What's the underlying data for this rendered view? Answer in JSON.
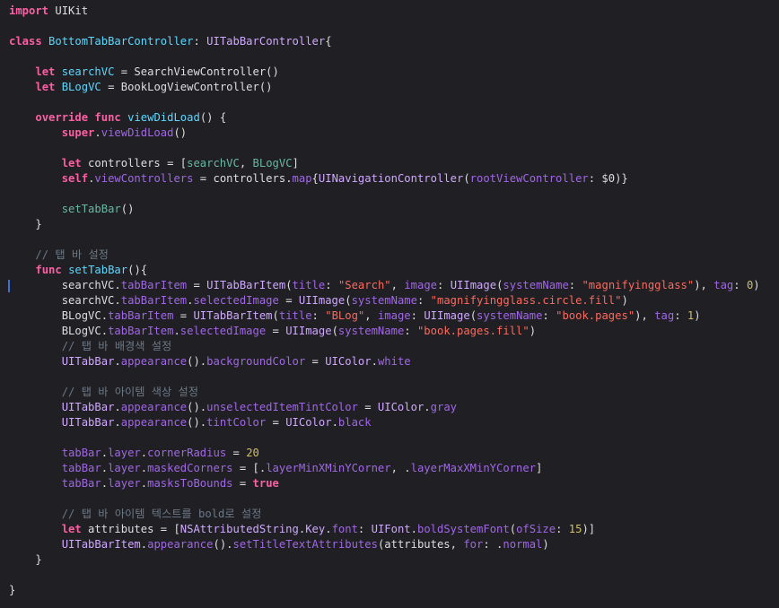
{
  "editor": {
    "theme_colors": {
      "background": "#1f1f24",
      "keyword": "#fc5fa3",
      "type": "#d0a8ff",
      "member": "#a167e6",
      "project_member": "#67b7a4",
      "declaration": "#5dd8ff",
      "string": "#fc6a5d",
      "number": "#d0bf69",
      "comment": "#6c7986",
      "text": "#dfdfe0"
    },
    "lines": [
      [
        {
          "k": "kw",
          "t": "import"
        },
        {
          "k": "tx",
          "t": " UIKit"
        }
      ],
      [],
      [
        {
          "k": "kw",
          "t": "class"
        },
        {
          "k": "tx",
          "t": " "
        },
        {
          "k": "cl",
          "t": "BottomTabBarController"
        },
        {
          "k": "tx",
          "t": ": "
        },
        {
          "k": "ty",
          "t": "UITabBarController"
        },
        {
          "k": "tx",
          "t": "{"
        }
      ],
      [],
      [
        {
          "k": "tx",
          "t": "    "
        },
        {
          "k": "kw",
          "t": "let"
        },
        {
          "k": "tx",
          "t": " "
        },
        {
          "k": "cl",
          "t": "searchVC"
        },
        {
          "k": "tx",
          "t": " = SearchViewController()"
        }
      ],
      [
        {
          "k": "tx",
          "t": "    "
        },
        {
          "k": "kw",
          "t": "let"
        },
        {
          "k": "tx",
          "t": " "
        },
        {
          "k": "cl",
          "t": "BLogVC"
        },
        {
          "k": "tx",
          "t": " = BookLogViewController()"
        }
      ],
      [],
      [
        {
          "k": "tx",
          "t": "    "
        },
        {
          "k": "kw",
          "t": "override"
        },
        {
          "k": "tx",
          "t": " "
        },
        {
          "k": "kw",
          "t": "func"
        },
        {
          "k": "tx",
          "t": " "
        },
        {
          "k": "cl",
          "t": "viewDidLoad"
        },
        {
          "k": "tx",
          "t": "() {"
        }
      ],
      [
        {
          "k": "tx",
          "t": "        "
        },
        {
          "k": "kw",
          "t": "super"
        },
        {
          "k": "tx",
          "t": "."
        },
        {
          "k": "pm",
          "t": "viewDidLoad"
        },
        {
          "k": "tx",
          "t": "()"
        }
      ],
      [],
      [
        {
          "k": "tx",
          "t": "        "
        },
        {
          "k": "kw",
          "t": "let"
        },
        {
          "k": "tx",
          "t": " controllers = ["
        },
        {
          "k": "fn",
          "t": "searchVC"
        },
        {
          "k": "tx",
          "t": ", "
        },
        {
          "k": "fn",
          "t": "BLogVC"
        },
        {
          "k": "tx",
          "t": "]"
        }
      ],
      [
        {
          "k": "tx",
          "t": "        "
        },
        {
          "k": "kw",
          "t": "self"
        },
        {
          "k": "tx",
          "t": "."
        },
        {
          "k": "pm",
          "t": "viewControllers"
        },
        {
          "k": "tx",
          "t": " = controllers."
        },
        {
          "k": "pm",
          "t": "map"
        },
        {
          "k": "tx",
          "t": "{"
        },
        {
          "k": "ty",
          "t": "UINavigationController"
        },
        {
          "k": "tx",
          "t": "("
        },
        {
          "k": "pm",
          "t": "rootViewController"
        },
        {
          "k": "tx",
          "t": ": $0)}"
        }
      ],
      [],
      [
        {
          "k": "tx",
          "t": "        "
        },
        {
          "k": "fn",
          "t": "setTabBar"
        },
        {
          "k": "tx",
          "t": "()"
        }
      ],
      [
        {
          "k": "tx",
          "t": "    }"
        }
      ],
      [],
      [
        {
          "k": "tx",
          "t": "    "
        },
        {
          "k": "cm",
          "t": "// 탭 바 설정"
        }
      ],
      [
        {
          "k": "tx",
          "t": "    "
        },
        {
          "k": "kw",
          "t": "func"
        },
        {
          "k": "tx",
          "t": " "
        },
        {
          "k": "cl",
          "t": "setTabBar"
        },
        {
          "k": "tx",
          "t": "(){"
        }
      ],
      [
        {
          "k": "tx",
          "t": "        searchVC."
        },
        {
          "k": "pm",
          "t": "tabBarItem"
        },
        {
          "k": "tx",
          "t": " = "
        },
        {
          "k": "ty",
          "t": "UITabBarItem"
        },
        {
          "k": "tx",
          "t": "("
        },
        {
          "k": "pm",
          "t": "title"
        },
        {
          "k": "tx",
          "t": ": "
        },
        {
          "k": "st",
          "t": "\"Search\""
        },
        {
          "k": "tx",
          "t": ", "
        },
        {
          "k": "pm",
          "t": "image"
        },
        {
          "k": "tx",
          "t": ": "
        },
        {
          "k": "ty",
          "t": "UIImage"
        },
        {
          "k": "tx",
          "t": "("
        },
        {
          "k": "pm",
          "t": "systemName"
        },
        {
          "k": "tx",
          "t": ": "
        },
        {
          "k": "st",
          "t": "\"magnifyingglass\""
        },
        {
          "k": "tx",
          "t": "), "
        },
        {
          "k": "pm",
          "t": "tag"
        },
        {
          "k": "tx",
          "t": ": "
        },
        {
          "k": "nu",
          "t": "0"
        },
        {
          "k": "tx",
          "t": ")"
        }
      ],
      [
        {
          "k": "tx",
          "t": "        searchVC."
        },
        {
          "k": "pm",
          "t": "tabBarItem"
        },
        {
          "k": "tx",
          "t": "."
        },
        {
          "k": "pm",
          "t": "selectedImage"
        },
        {
          "k": "tx",
          "t": " = "
        },
        {
          "k": "ty",
          "t": "UIImage"
        },
        {
          "k": "tx",
          "t": "("
        },
        {
          "k": "pm",
          "t": "systemName"
        },
        {
          "k": "tx",
          "t": ": "
        },
        {
          "k": "st",
          "t": "\"magnifyingglass.circle.fill\""
        },
        {
          "k": "tx",
          "t": ")"
        }
      ],
      [
        {
          "k": "tx",
          "t": "        BLogVC."
        },
        {
          "k": "pm",
          "t": "tabBarItem"
        },
        {
          "k": "tx",
          "t": " = "
        },
        {
          "k": "ty",
          "t": "UITabBarItem"
        },
        {
          "k": "tx",
          "t": "("
        },
        {
          "k": "pm",
          "t": "title"
        },
        {
          "k": "tx",
          "t": ": "
        },
        {
          "k": "st",
          "t": "\"BLog\""
        },
        {
          "k": "tx",
          "t": ", "
        },
        {
          "k": "pm",
          "t": "image"
        },
        {
          "k": "tx",
          "t": ": "
        },
        {
          "k": "ty",
          "t": "UIImage"
        },
        {
          "k": "tx",
          "t": "("
        },
        {
          "k": "pm",
          "t": "systemName"
        },
        {
          "k": "tx",
          "t": ": "
        },
        {
          "k": "st",
          "t": "\"book.pages\""
        },
        {
          "k": "tx",
          "t": "), "
        },
        {
          "k": "pm",
          "t": "tag"
        },
        {
          "k": "tx",
          "t": ": "
        },
        {
          "k": "nu",
          "t": "1"
        },
        {
          "k": "tx",
          "t": ")"
        }
      ],
      [
        {
          "k": "tx",
          "t": "        BLogVC."
        },
        {
          "k": "pm",
          "t": "tabBarItem"
        },
        {
          "k": "tx",
          "t": "."
        },
        {
          "k": "pm",
          "t": "selectedImage"
        },
        {
          "k": "tx",
          "t": " = "
        },
        {
          "k": "ty",
          "t": "UIImage"
        },
        {
          "k": "tx",
          "t": "("
        },
        {
          "k": "pm",
          "t": "systemName"
        },
        {
          "k": "tx",
          "t": ": "
        },
        {
          "k": "st",
          "t": "\"book.pages.fill\""
        },
        {
          "k": "tx",
          "t": ")"
        }
      ],
      [
        {
          "k": "tx",
          "t": "        "
        },
        {
          "k": "cm",
          "t": "// 탭 바 배경색 설정"
        }
      ],
      [
        {
          "k": "tx",
          "t": "        "
        },
        {
          "k": "ty",
          "t": "UITabBar"
        },
        {
          "k": "tx",
          "t": "."
        },
        {
          "k": "pm",
          "t": "appearance"
        },
        {
          "k": "tx",
          "t": "()."
        },
        {
          "k": "pm",
          "t": "backgroundColor"
        },
        {
          "k": "tx",
          "t": " = "
        },
        {
          "k": "ty",
          "t": "UIColor"
        },
        {
          "k": "tx",
          "t": "."
        },
        {
          "k": "pm",
          "t": "white"
        }
      ],
      [],
      [
        {
          "k": "tx",
          "t": "        "
        },
        {
          "k": "cm",
          "t": "// 탭 바 아이템 색상 설정"
        }
      ],
      [
        {
          "k": "tx",
          "t": "        "
        },
        {
          "k": "ty",
          "t": "UITabBar"
        },
        {
          "k": "tx",
          "t": "."
        },
        {
          "k": "pm",
          "t": "appearance"
        },
        {
          "k": "tx",
          "t": "()."
        },
        {
          "k": "pm",
          "t": "unselectedItemTintColor"
        },
        {
          "k": "tx",
          "t": " = "
        },
        {
          "k": "ty",
          "t": "UIColor"
        },
        {
          "k": "tx",
          "t": "."
        },
        {
          "k": "pm",
          "t": "gray"
        }
      ],
      [
        {
          "k": "tx",
          "t": "        "
        },
        {
          "k": "ty",
          "t": "UITabBar"
        },
        {
          "k": "tx",
          "t": "."
        },
        {
          "k": "pm",
          "t": "appearance"
        },
        {
          "k": "tx",
          "t": "()."
        },
        {
          "k": "pm",
          "t": "tintColor"
        },
        {
          "k": "tx",
          "t": " = "
        },
        {
          "k": "ty",
          "t": "UIColor"
        },
        {
          "k": "tx",
          "t": "."
        },
        {
          "k": "pm",
          "t": "black"
        }
      ],
      [],
      [
        {
          "k": "tx",
          "t": "        "
        },
        {
          "k": "pm",
          "t": "tabBar"
        },
        {
          "k": "tx",
          "t": "."
        },
        {
          "k": "pm",
          "t": "layer"
        },
        {
          "k": "tx",
          "t": "."
        },
        {
          "k": "pm",
          "t": "cornerRadius"
        },
        {
          "k": "tx",
          "t": " = "
        },
        {
          "k": "nu",
          "t": "20"
        }
      ],
      [
        {
          "k": "tx",
          "t": "        "
        },
        {
          "k": "pm",
          "t": "tabBar"
        },
        {
          "k": "tx",
          "t": "."
        },
        {
          "k": "pm",
          "t": "layer"
        },
        {
          "k": "tx",
          "t": "."
        },
        {
          "k": "pm",
          "t": "maskedCorners"
        },
        {
          "k": "tx",
          "t": " = [."
        },
        {
          "k": "pm",
          "t": "layerMinXMinYCorner"
        },
        {
          "k": "tx",
          "t": ", ."
        },
        {
          "k": "pm",
          "t": "layerMaxXMinYCorner"
        },
        {
          "k": "tx",
          "t": "]"
        }
      ],
      [
        {
          "k": "tx",
          "t": "        "
        },
        {
          "k": "pm",
          "t": "tabBar"
        },
        {
          "k": "tx",
          "t": "."
        },
        {
          "k": "pm",
          "t": "layer"
        },
        {
          "k": "tx",
          "t": "."
        },
        {
          "k": "pm",
          "t": "masksToBounds"
        },
        {
          "k": "tx",
          "t": " = "
        },
        {
          "k": "kw",
          "t": "true"
        }
      ],
      [],
      [
        {
          "k": "tx",
          "t": "        "
        },
        {
          "k": "cm",
          "t": "// 탭 바 아이템 텍스트를 bold로 설정"
        }
      ],
      [
        {
          "k": "tx",
          "t": "        "
        },
        {
          "k": "kw",
          "t": "let"
        },
        {
          "k": "tx",
          "t": " attributes = ["
        },
        {
          "k": "ty",
          "t": "NSAttributedString"
        },
        {
          "k": "tx",
          "t": "."
        },
        {
          "k": "ty",
          "t": "Key"
        },
        {
          "k": "tx",
          "t": "."
        },
        {
          "k": "pm",
          "t": "font"
        },
        {
          "k": "tx",
          "t": ": "
        },
        {
          "k": "ty",
          "t": "UIFont"
        },
        {
          "k": "tx",
          "t": "."
        },
        {
          "k": "pm",
          "t": "boldSystemFont"
        },
        {
          "k": "tx",
          "t": "("
        },
        {
          "k": "pm",
          "t": "ofSize"
        },
        {
          "k": "tx",
          "t": ": "
        },
        {
          "k": "nu",
          "t": "15"
        },
        {
          "k": "tx",
          "t": ")]"
        }
      ],
      [
        {
          "k": "tx",
          "t": "        "
        },
        {
          "k": "ty",
          "t": "UITabBarItem"
        },
        {
          "k": "tx",
          "t": "."
        },
        {
          "k": "pm",
          "t": "appearance"
        },
        {
          "k": "tx",
          "t": "()."
        },
        {
          "k": "pm",
          "t": "setTitleTextAttributes"
        },
        {
          "k": "tx",
          "t": "(attributes, "
        },
        {
          "k": "pm",
          "t": "for"
        },
        {
          "k": "tx",
          "t": ": ."
        },
        {
          "k": "pm",
          "t": "normal"
        },
        {
          "k": "tx",
          "t": ")"
        }
      ],
      [
        {
          "k": "tx",
          "t": "    }"
        }
      ],
      [],
      [
        {
          "k": "tx",
          "t": "}"
        }
      ]
    ]
  }
}
